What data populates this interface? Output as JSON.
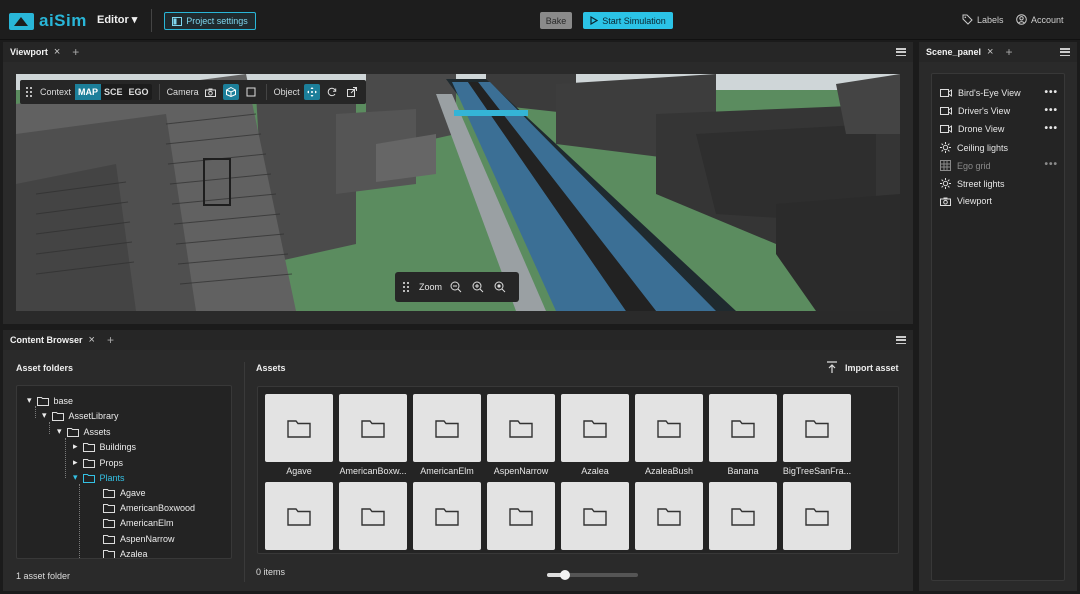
{
  "app": {
    "logo_text": "aiSim",
    "editor_menu": "Editor",
    "project_settings": "Project settings",
    "bake": "Bake",
    "start_simulation": "Start Simulation",
    "labels": "Labels",
    "account": "Account",
    "accent": "#29b6d8"
  },
  "viewport": {
    "tab": "Viewport",
    "toolbar": {
      "context_label": "Context",
      "context_modes": [
        "MAP",
        "SCE",
        "EGO"
      ],
      "context_active": "MAP",
      "camera_label": "Camera",
      "object_label": "Object"
    },
    "zoom_label": "Zoom"
  },
  "scene_panel": {
    "tab": "Scene_panel",
    "items": [
      {
        "label": "Bird's-Eye View",
        "icon": "video-camera-icon",
        "menu": "•••"
      },
      {
        "label": "Driver's View",
        "icon": "video-camera-icon",
        "menu": "•••"
      },
      {
        "label": "Drone View",
        "icon": "video-camera-icon",
        "menu": "•••"
      },
      {
        "label": "Ceiling lights",
        "icon": "sun-icon",
        "menu": ""
      },
      {
        "label": "Ego grid",
        "icon": "grid-icon",
        "menu": "•••"
      },
      {
        "label": "Street lights",
        "icon": "sun-icon",
        "menu": ""
      },
      {
        "label": "Viewport",
        "icon": "camera-icon",
        "menu": ""
      }
    ]
  },
  "content_browser": {
    "tab": "Content Browser",
    "asset_folders_title": "Asset folders",
    "assets_title": "Assets",
    "import_asset": "Import asset",
    "tree": {
      "base": "base",
      "asset_library": "AssetLibrary",
      "assets": "Assets",
      "buildings": "Buildings",
      "props": "Props",
      "plants": "Plants",
      "leaves": [
        "Agave",
        "AmericanBoxwood",
        "AmericanElm",
        "AspenNarrow",
        "Azalea"
      ]
    },
    "folder_count": "1 asset folder",
    "items_count": "0 items",
    "asset_tiles": [
      "Agave",
      "AmericanBoxw...",
      "AmericanElm",
      "AspenNarrow",
      "Azalea",
      "AzaleaBush",
      "Banana",
      "BigTreeSanFra..."
    ],
    "thumbnail_size": 0.2
  }
}
